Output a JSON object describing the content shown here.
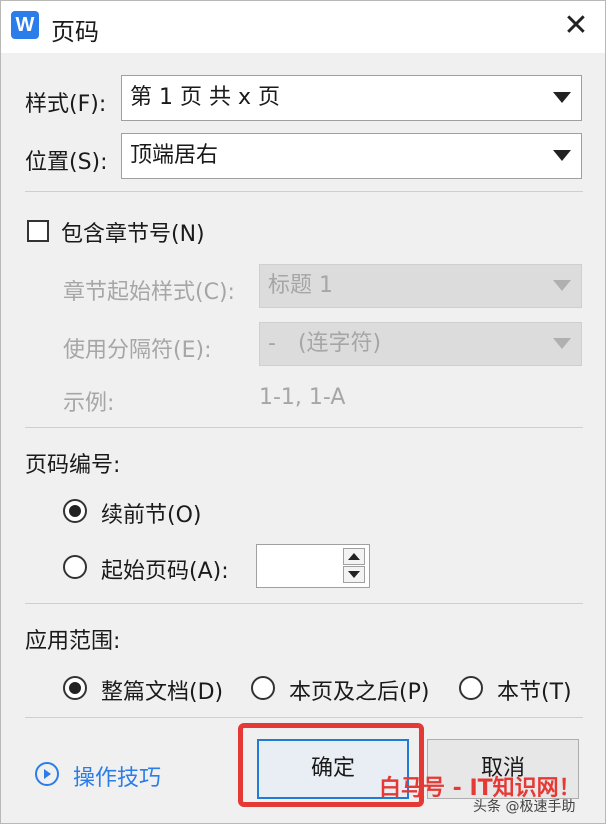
{
  "dialog": {
    "title": "页码",
    "app_icon_letter": "W",
    "close_symbol": "✕"
  },
  "style_row": {
    "label": "样式(F):",
    "value": "第 1 页 共 x 页"
  },
  "position_row": {
    "label": "位置(S):",
    "value": "顶端居右"
  },
  "chapter": {
    "checkbox_label": "包含章节号(N)",
    "checked": false,
    "start_style_label": "章节起始样式(C):",
    "start_style_value": "标题 1",
    "separator_label": "使用分隔符(E):",
    "separator_value": "-　(连字符)",
    "example_label": "示例:",
    "example_value": "1-1, 1-A"
  },
  "numbering": {
    "heading": "页码编号:",
    "continue_label": "续前节(O)",
    "start_label": "起始页码(A):",
    "selected": "continue",
    "start_value": ""
  },
  "scope": {
    "heading": "应用范围:",
    "options": [
      "整篇文档(D)",
      "本页及之后(P)",
      "本节(T)"
    ],
    "selected": "整篇文档(D)"
  },
  "footer": {
    "tips_label": "操作技巧",
    "ok_label": "确定",
    "cancel_label": "取消"
  },
  "watermark": {
    "red_text": "白马号 - IT知识网！",
    "small_text": "头条 @极速手助"
  },
  "colors": {
    "accent": "#2b7de9",
    "highlight_border": "#e53935",
    "disabled_text": "#a6a6a6"
  }
}
